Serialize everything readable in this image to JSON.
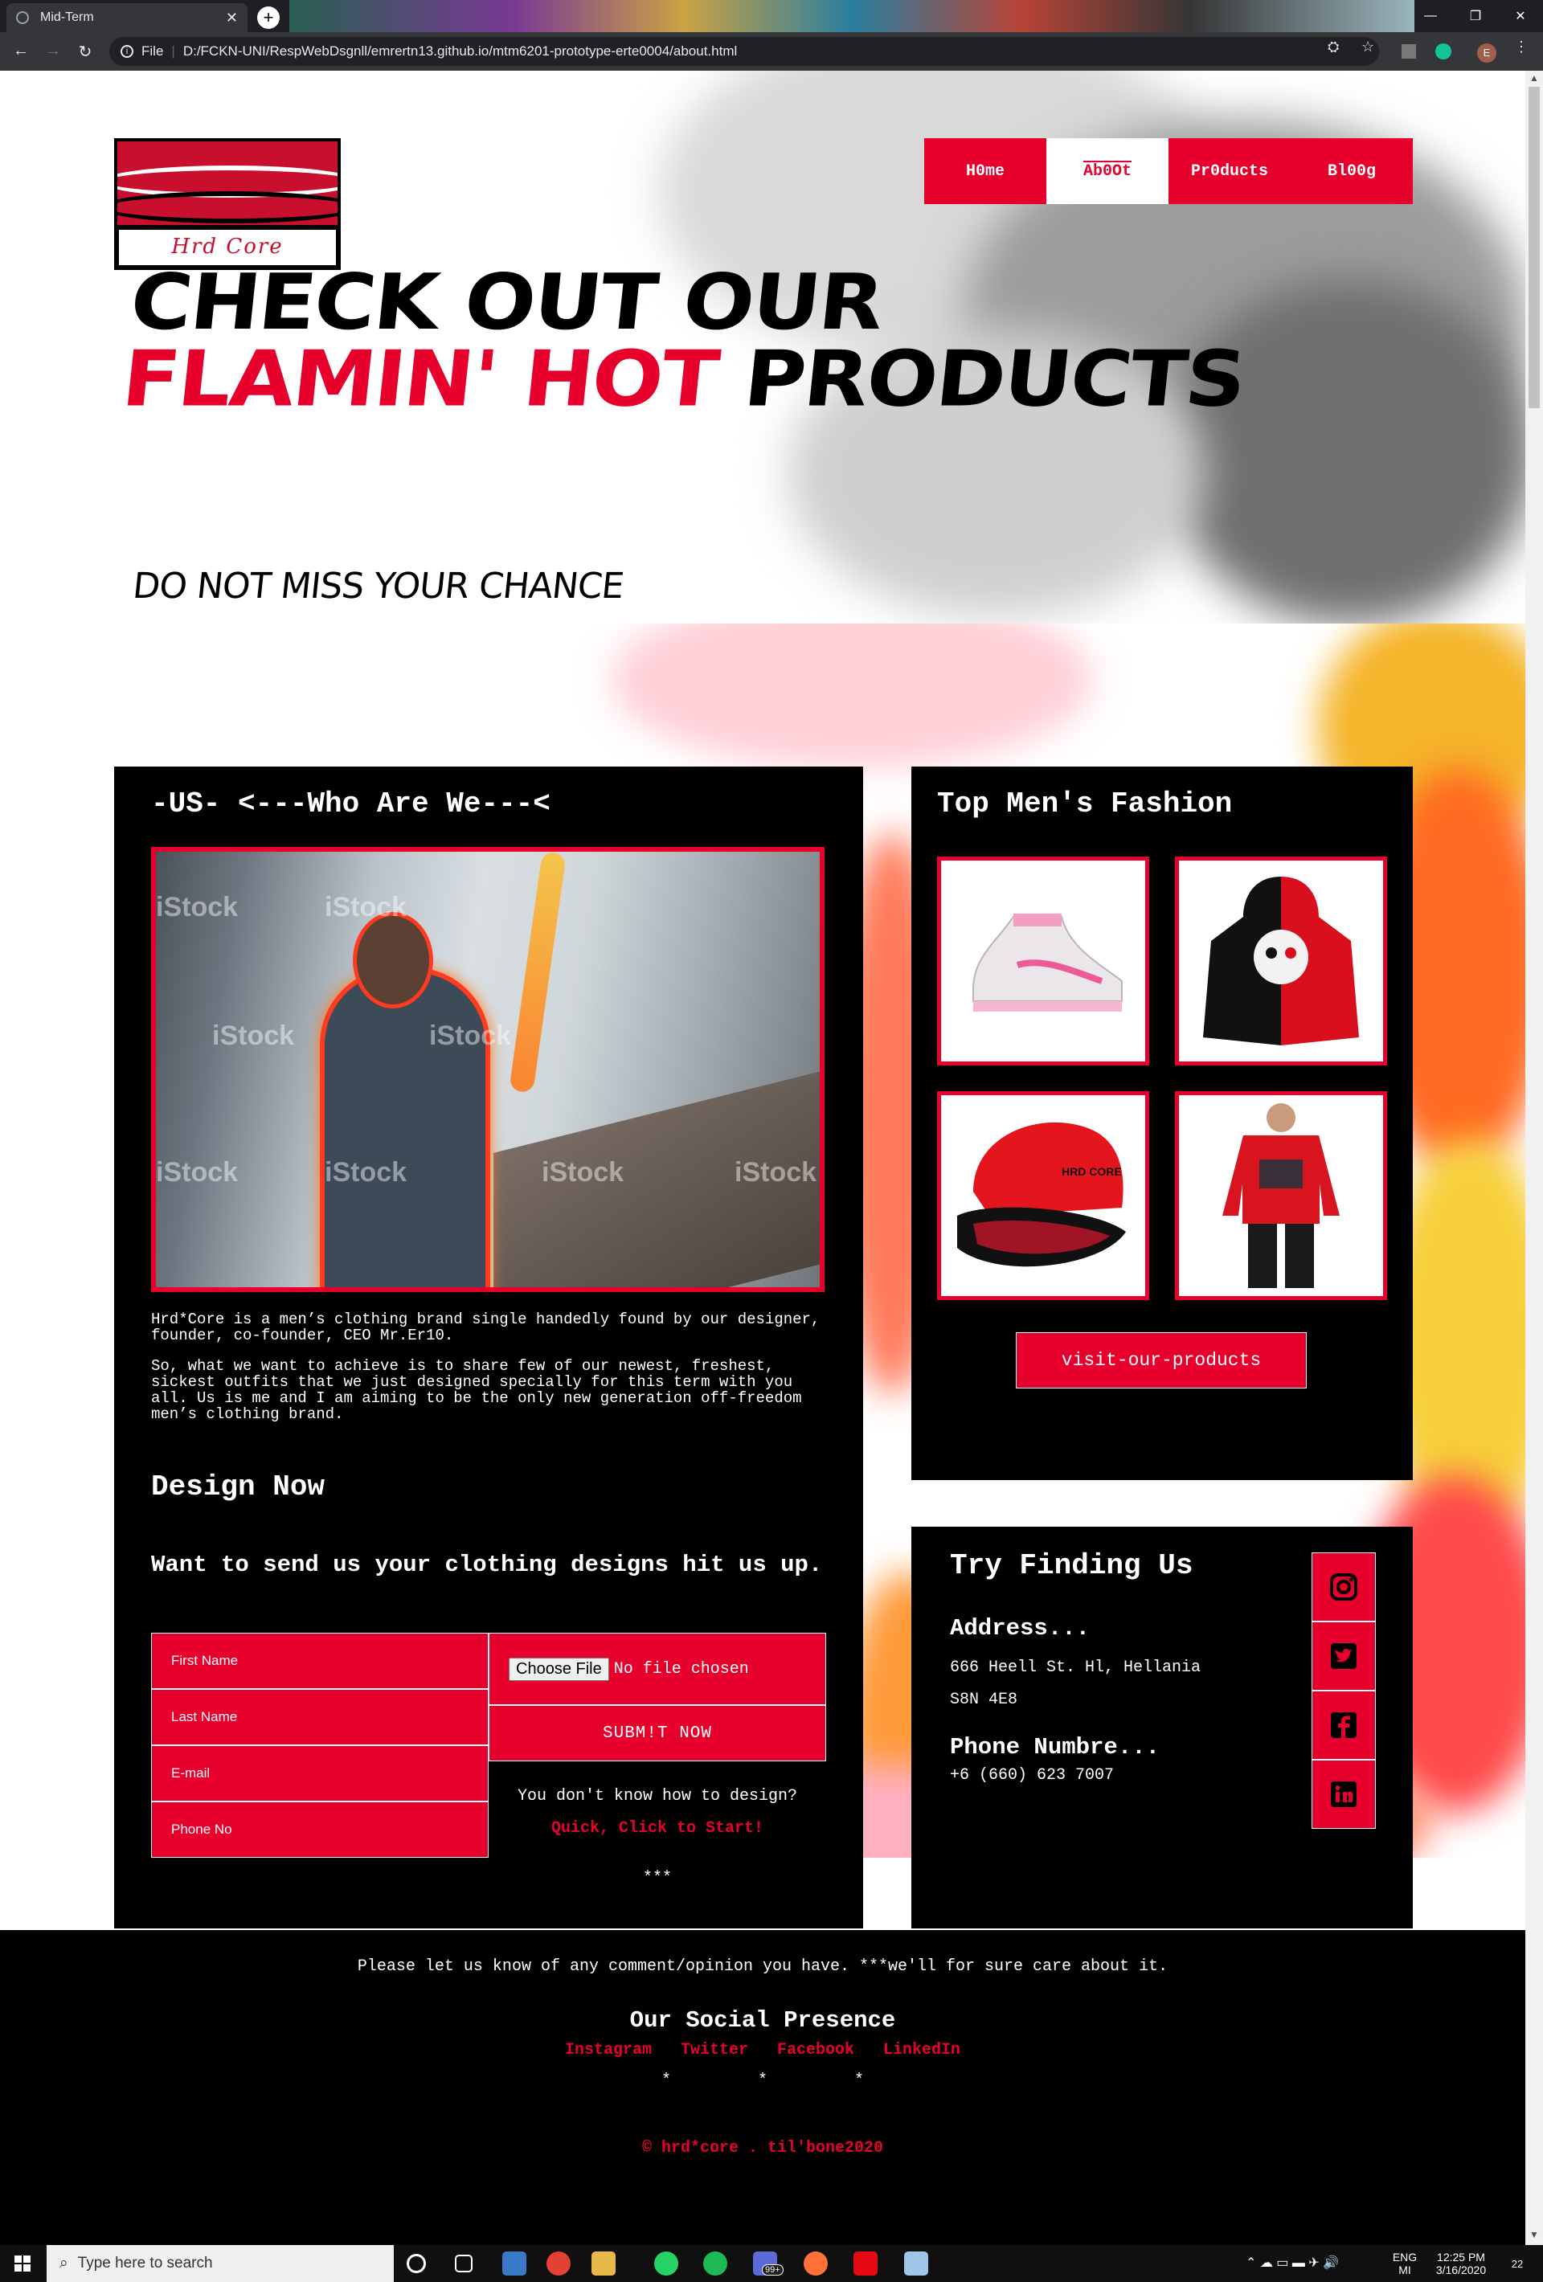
{
  "browser": {
    "tab_title": "Mid-Term",
    "tab_close": "✕",
    "new_tab": "+",
    "window_controls": [
      "—",
      "❐",
      "✕"
    ],
    "address_scheme": "File",
    "address_url": "D:/FCKN-UNI/RespWebDsgnll/emrertn13.github.io/mtm6201-prototype-erte0004/about.html",
    "profile_initial": "E"
  },
  "header": {
    "logo_text": "Hrd Core",
    "nav": [
      {
        "label": "H0me"
      },
      {
        "label": "Ab0Ot"
      },
      {
        "label": "Pr0ducts"
      },
      {
        "label": "Bl00g"
      }
    ],
    "hero_line1": "CHECK OUT OUR",
    "hero_line2_red": "FLAMIN' HOT",
    "hero_line2_black": "PRODUCTS",
    "hero_sub": "DO NOT MISS YOUR CHANCE"
  },
  "about": {
    "title": "-US- <---Who Are We---<",
    "paragraph1": "Hrd*Core is a men’s clothing brand single handedly found by our designer, founder, co-founder, CEO Mr.Er10.",
    "paragraph2": "So, what we want to achieve is to share few of our newest, freshest, sickest outfits that we just designed specially for this term with you all. Us is me and I am aiming to be the only new generation off-freedom men’s clothing brand.",
    "watermark": "iStock",
    "design_title": "Design Now",
    "design_sub": "Want to send us your clothing designs hit us up.",
    "fields": [
      "First Name",
      "Last Name",
      "E-mail",
      "Phone No"
    ],
    "file_button": "Choose File",
    "file_status": "No file chosen",
    "submit": "SUBM!T NOW",
    "hint": "You don't know how to design?",
    "hint_link": "Quick, Click to Start!",
    "stars": "***"
  },
  "fashion": {
    "title": "Top Men's Fashion",
    "products": [
      "sneaker",
      "split-hoodie",
      "snapback-cap",
      "red-hoodie"
    ],
    "cap_text": "HRD CORE",
    "button": "visit-our-products"
  },
  "contact": {
    "title": "Try Finding Us",
    "address_label": "Address...",
    "address_line1": "666 Heell St. Hl, Hellania",
    "address_line2": "S8N 4E8",
    "phone_label": "Phone Numbre...",
    "phone": "+6 (660) 623 7007",
    "social_icons": [
      "instagram-icon",
      "twitter-icon",
      "facebook-icon",
      "linkedin-icon"
    ]
  },
  "footer": {
    "message": "Please let us know of any comment/opinion you have. ***we'll for sure care about it.",
    "social_title": "Our Social Presence",
    "links": [
      "Instagram",
      "Twitter",
      "Facebook",
      "LinkedIn"
    ],
    "stars": "*         *         *",
    "copyright": "© hrd*core . til'bone2020"
  },
  "taskbar": {
    "search_placeholder": "Type here to search",
    "badge": "99+",
    "lang1": "ENG",
    "lang2": "MI",
    "time": "12:25 PM",
    "date": "3/16/2020",
    "notif_count": "22"
  },
  "colors": {
    "brand_red": "#e8002c",
    "card_black": "#000000"
  }
}
